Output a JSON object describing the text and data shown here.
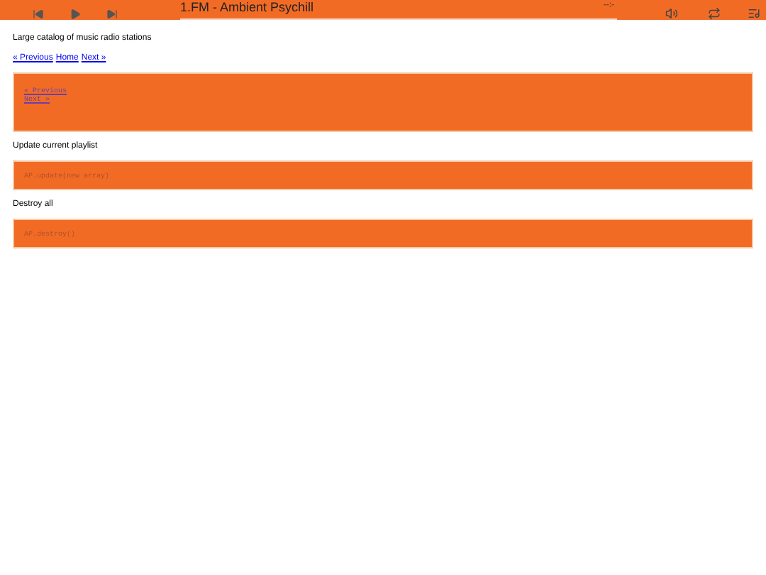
{
  "player": {
    "title": "1.FM - Ambient Psychill",
    "time": "--:-"
  },
  "intro": "Large catalog of music radio stations",
  "nav": [
    {
      "label": "« Previous"
    },
    {
      "label": "Home"
    },
    {
      "label": "Next »"
    }
  ],
  "sections": [
    {
      "kind": "links",
      "links": [
        "« Previous",
        "Next »"
      ]
    },
    {
      "kind": "code",
      "heading": "Update current playlist",
      "code": "AP.update(new array)"
    },
    {
      "kind": "code",
      "heading": "Destroy all",
      "code": "AP.destroy()"
    }
  ]
}
